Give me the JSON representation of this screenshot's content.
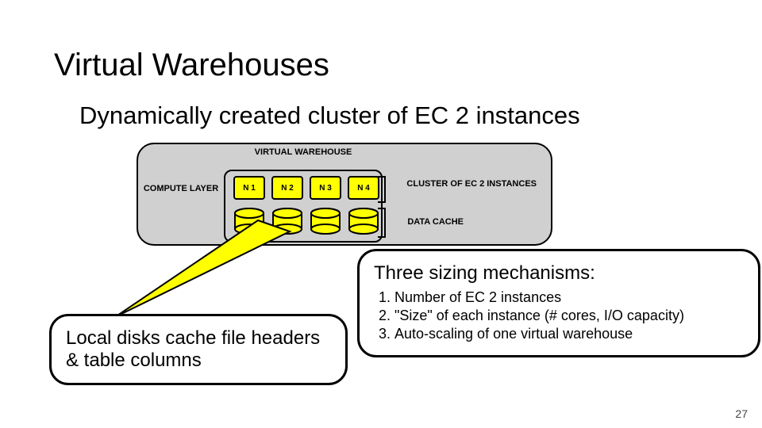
{
  "title": "Virtual Warehouses",
  "subtitle": "Dynamically created cluster of EC 2 instances",
  "layer_label": "COMPUTE LAYER",
  "vw_label": "VIRTUAL WAREHOUSE",
  "nodes": [
    "N 1",
    "N 2",
    "N 3",
    "N 4"
  ],
  "cluster_caption": "CLUSTER OF EC 2 INSTANCES",
  "cache_caption": "DATA CACHE",
  "callout_left": "Local disks cache file headers & table columns",
  "callout_right_heading": "Three sizing mechanisms:",
  "callout_right_items": [
    "Number of EC 2 instances",
    "\"Size\" of each instance (# cores, I/O capacity)",
    "Auto-scaling of one virtual warehouse"
  ],
  "page_number": "27"
}
